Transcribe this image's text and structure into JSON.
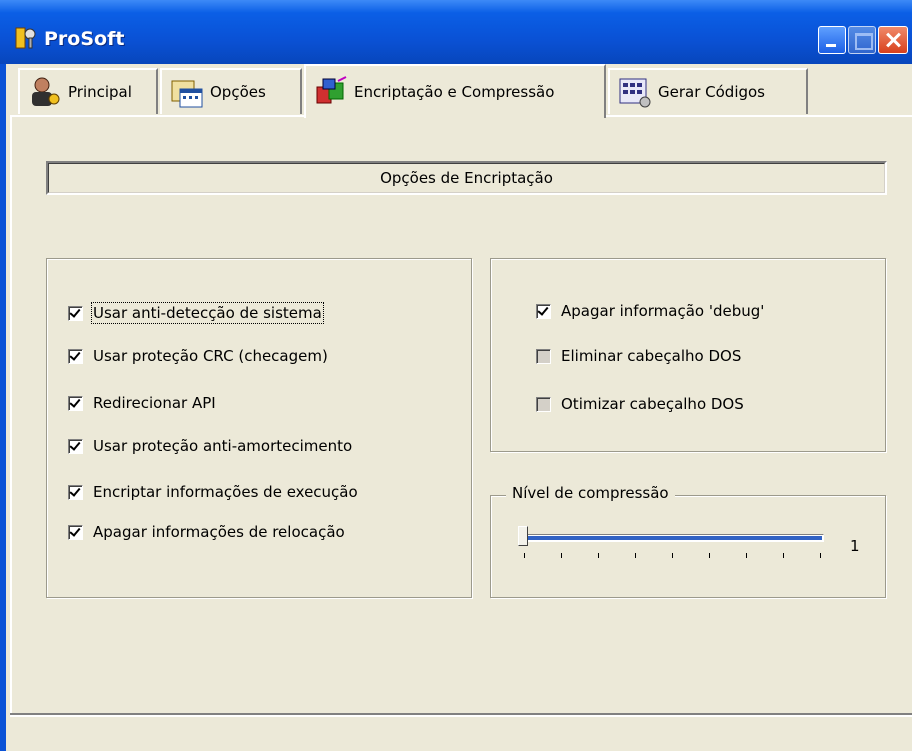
{
  "window": {
    "title": "ProSoft"
  },
  "tabs": [
    {
      "label": "Principal",
      "icon": "user-key-icon"
    },
    {
      "label": "Opções",
      "icon": "calendar-folder-icon"
    },
    {
      "label": "Encriptação e Compressão",
      "icon": "compress-box-icon",
      "active": true
    },
    {
      "label": "Gerar Códigos",
      "icon": "code-grid-icon"
    }
  ],
  "header_panel": {
    "text": "Opções de  Encriptação"
  },
  "left_options": [
    {
      "label": "Usar anti-detecção de sistema",
      "checked": true,
      "focused": true
    },
    {
      "label": "Usar proteção CRC (checagem)",
      "checked": true
    },
    {
      "label": "Redirecionar API",
      "checked": true
    },
    {
      "label": "Usar proteção anti-amortecimento",
      "checked": true
    },
    {
      "label": "Encriptar informações de execução",
      "checked": true
    },
    {
      "label": "Apagar informações de relocação",
      "checked": true
    }
  ],
  "right_options": [
    {
      "label": "Apagar informação 'debug'",
      "checked": true
    },
    {
      "label": "Eliminar cabeçalho DOS",
      "checked": false
    },
    {
      "label": "Otimizar cabeçalho DOS",
      "checked": false
    }
  ],
  "compression": {
    "legend": "Nível de compressão",
    "value": "1",
    "level_fraction": 0
  },
  "colors": {
    "titlebar": "#0a52d6",
    "window_bg": "#ece9d8",
    "slider_fill": "#3162c4"
  }
}
